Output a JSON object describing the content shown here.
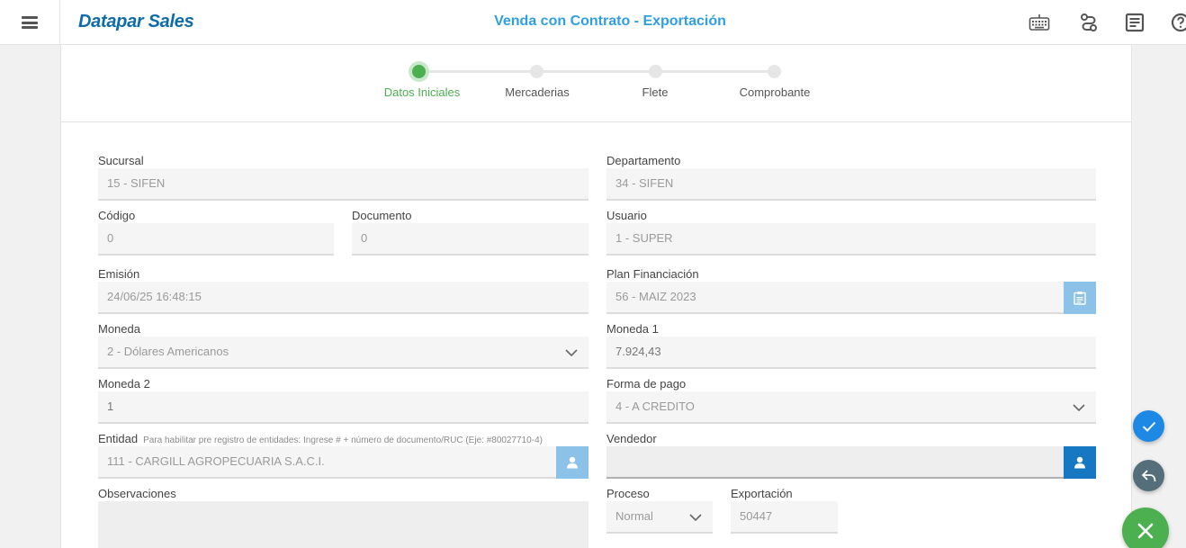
{
  "header": {
    "brand": "Datapar Sales",
    "title": "Venda con Contrato - Exportación",
    "icons": [
      "keyboard-icon",
      "route-icon",
      "document-icon",
      "help-icon"
    ]
  },
  "stepper": {
    "steps": [
      {
        "label": "Datos Iniciales",
        "active": true
      },
      {
        "label": "Mercaderias",
        "active": false
      },
      {
        "label": "Flete",
        "active": false
      },
      {
        "label": "Comprobante",
        "active": false
      }
    ]
  },
  "form": {
    "sucursal": {
      "label": "Sucursal",
      "value": "15 - SIFEN"
    },
    "departamento": {
      "label": "Departamento",
      "value": "34 - SIFEN"
    },
    "codigo": {
      "label": "Código",
      "value": "0"
    },
    "documento": {
      "label": "Documento",
      "value": "0"
    },
    "usuario": {
      "label": "Usuario",
      "value": "1 - SUPER"
    },
    "emision": {
      "label": "Emisión",
      "value": "24/06/25 16:48:15"
    },
    "plan": {
      "label": "Plan Financiación",
      "value": "56 - MAIZ 2023"
    },
    "moneda": {
      "label": "Moneda",
      "value": "2 - Dólares Americanos"
    },
    "moneda1": {
      "label": "Moneda 1",
      "value": "7.924,43"
    },
    "moneda2": {
      "label": "Moneda 2",
      "value": "1"
    },
    "forma_pago": {
      "label": "Forma de pago",
      "value": "4 - A CREDITO"
    },
    "entidad": {
      "label": "Entidad",
      "hint": "Para habilitar pre registro de entidades: Ingrese # + número de documento/RUC (Eje: #80027710-4)",
      "value": "111 - CARGILL AGROPECUARIA S.A.C.I."
    },
    "vendedor": {
      "label": "Vendedor",
      "value": ""
    },
    "observaciones": {
      "label": "Observaciones",
      "value": ""
    },
    "proceso": {
      "label": "Proceso",
      "value": "Normal"
    },
    "exportacion": {
      "label": "Exportación",
      "value": "50447"
    }
  },
  "colors": {
    "brand": "#0f6cab",
    "title": "#2f9fe2",
    "step_active": "#4caf50",
    "fab_confirm": "#1e88e5",
    "fab_back": "#546e7a",
    "fab_close": "#4caf50",
    "side_button_light": "#8cc2e8",
    "side_button_dark": "#1678c2"
  }
}
